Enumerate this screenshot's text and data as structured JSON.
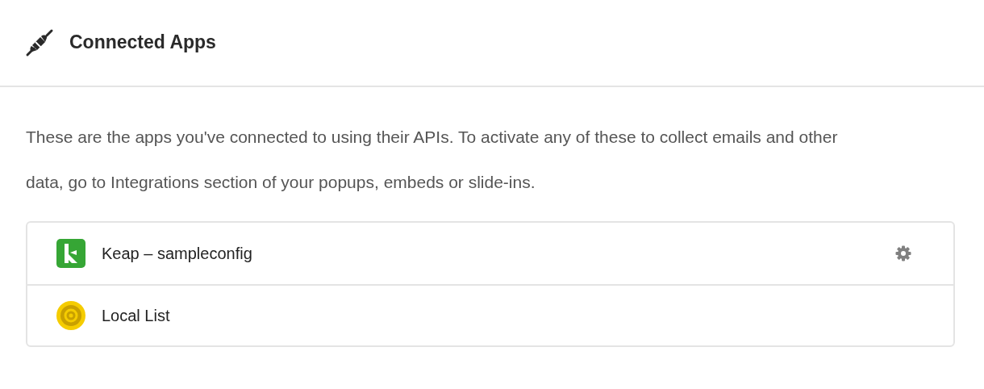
{
  "header": {
    "title": "Connected Apps"
  },
  "description": "These are the apps you've connected to using their APIs. To activate any of these to collect emails and other data, go to Integrations section of your popups, embeds or slide-ins.",
  "apps": [
    {
      "kind": "keap",
      "name": "Keap – sampleconfig",
      "has_settings": true
    },
    {
      "kind": "local",
      "name": "Local List",
      "has_settings": false
    }
  ]
}
